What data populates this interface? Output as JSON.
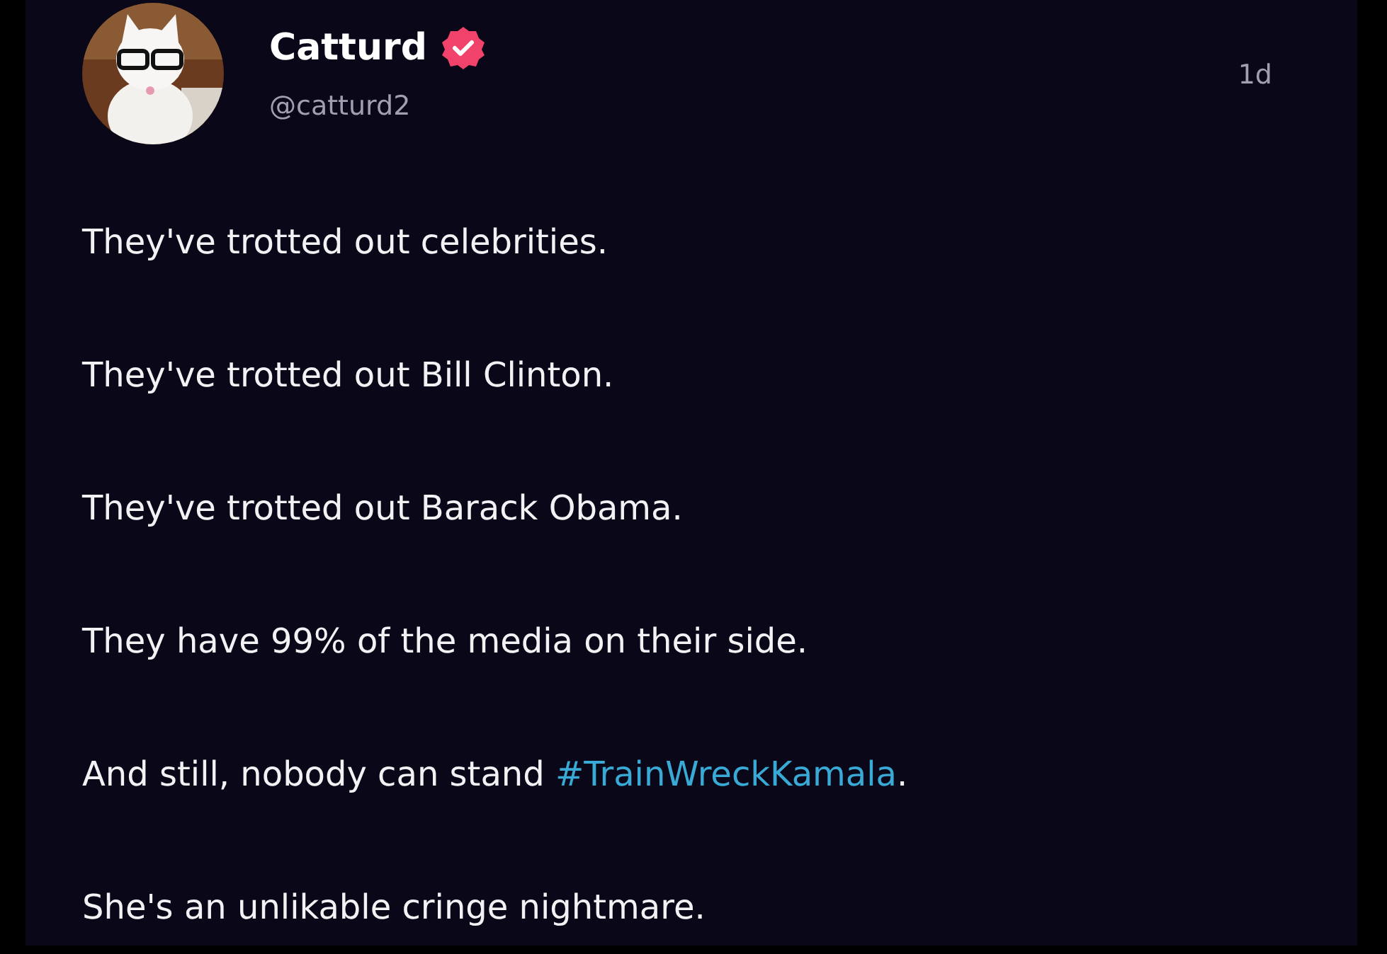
{
  "post": {
    "author": {
      "name": "Catturd",
      "verified": true,
      "handle": "@catturd2"
    },
    "time": "1d",
    "paragraphs": [
      {
        "segments": [
          {
            "kind": "text",
            "text": "They've trotted out celebrities."
          }
        ]
      },
      {
        "segments": [
          {
            "kind": "text",
            "text": "They've trotted out Bill Clinton."
          }
        ]
      },
      {
        "segments": [
          {
            "kind": "text",
            "text": "They've trotted out Barack Obama."
          }
        ]
      },
      {
        "segments": [
          {
            "kind": "text",
            "text": "They have 99% of the media on their side."
          }
        ]
      },
      {
        "segments": [
          {
            "kind": "text",
            "text": "And still, nobody can stand "
          },
          {
            "kind": "hashtag",
            "text": "#TrainWreckKamala"
          },
          {
            "kind": "text",
            "text": "."
          }
        ]
      },
      {
        "segments": [
          {
            "kind": "text",
            "text": "She's an unlikable cringe nightmare."
          }
        ]
      }
    ]
  }
}
